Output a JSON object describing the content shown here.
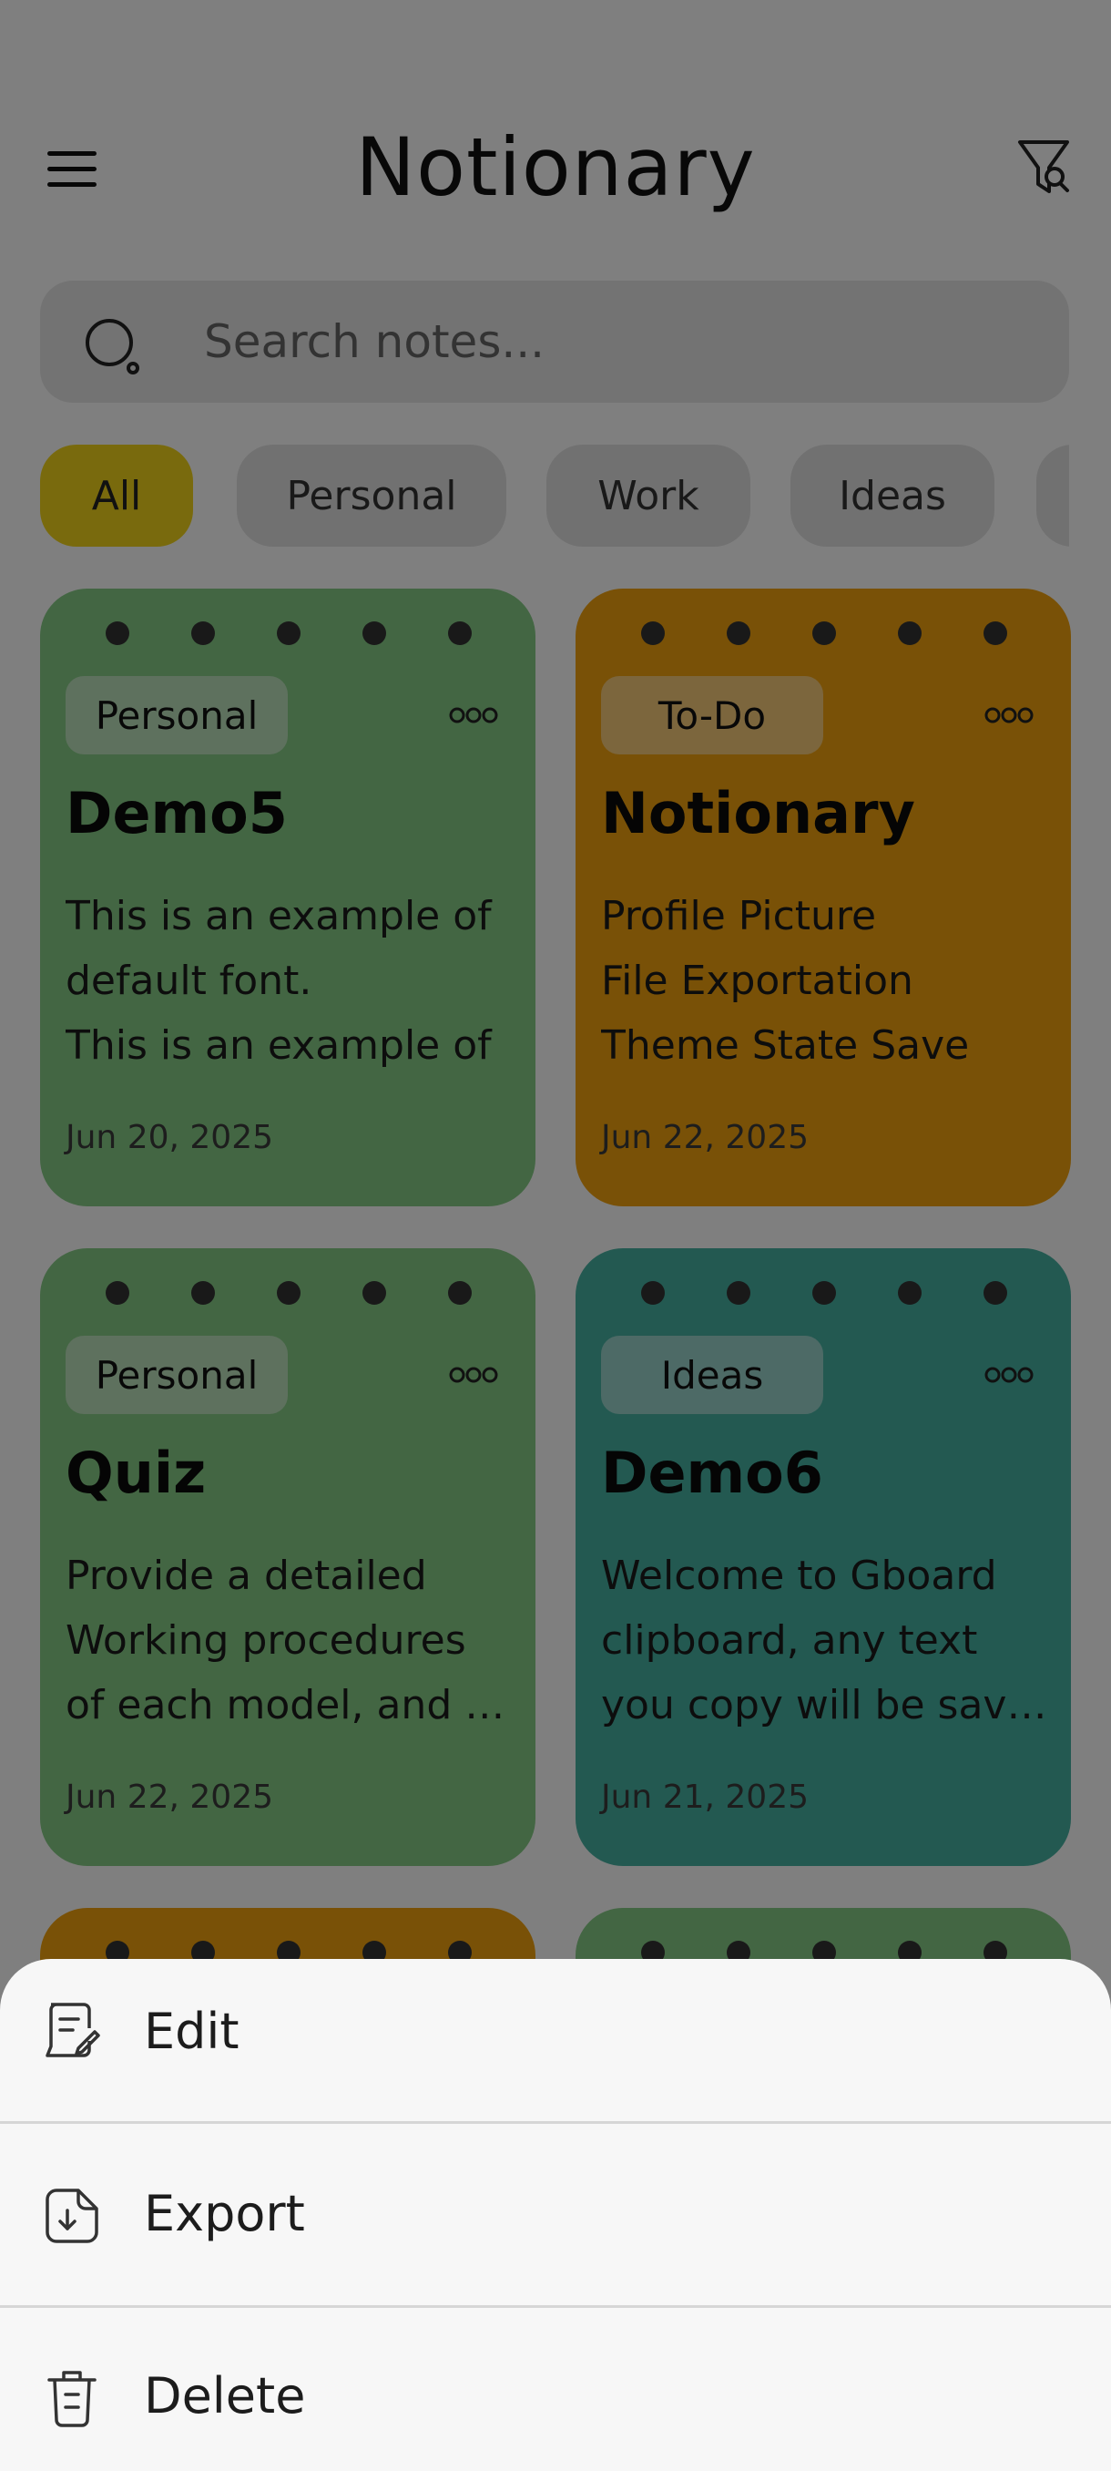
{
  "app": {
    "title": "Notionary"
  },
  "search": {
    "placeholder": "Search notes..."
  },
  "filters": [
    "All",
    "Personal",
    "Work",
    "Ideas"
  ],
  "colors": {
    "accent": "#f2d41b",
    "personal": "#86cc86",
    "todo": "#f2a20e",
    "ideas": "#47b2a2",
    "sheet": "#f7f7f7"
  },
  "notes": [
    {
      "tag": "Personal",
      "title": "Demo5",
      "lines": [
        "This is an example of",
        "default font.",
        "This is an example of"
      ],
      "date": "Jun 20, 2025"
    },
    {
      "tag": "To-Do",
      "title": "Notionary",
      "lines": [
        "Profile Picture",
        "File Exportation",
        "Theme State Save"
      ],
      "date": "Jun 22, 2025"
    },
    {
      "tag": "Personal",
      "title": "Quiz",
      "lines": [
        "Provide a detailed",
        "Working procedures",
        "of each model, and how"
      ],
      "date": "Jun 22, 2025"
    },
    {
      "tag": "Ideas",
      "title": "Demo6",
      "lines": [
        "Welcome to Gboard",
        "clipboard, any text",
        "you copy will be saved"
      ],
      "date": "Jun 21, 2025"
    }
  ],
  "actions": [
    {
      "label": "Edit",
      "icon": "edit-note-icon"
    },
    {
      "label": "Export",
      "icon": "export-icon"
    },
    {
      "label": "Delete",
      "icon": "trash-icon"
    }
  ]
}
